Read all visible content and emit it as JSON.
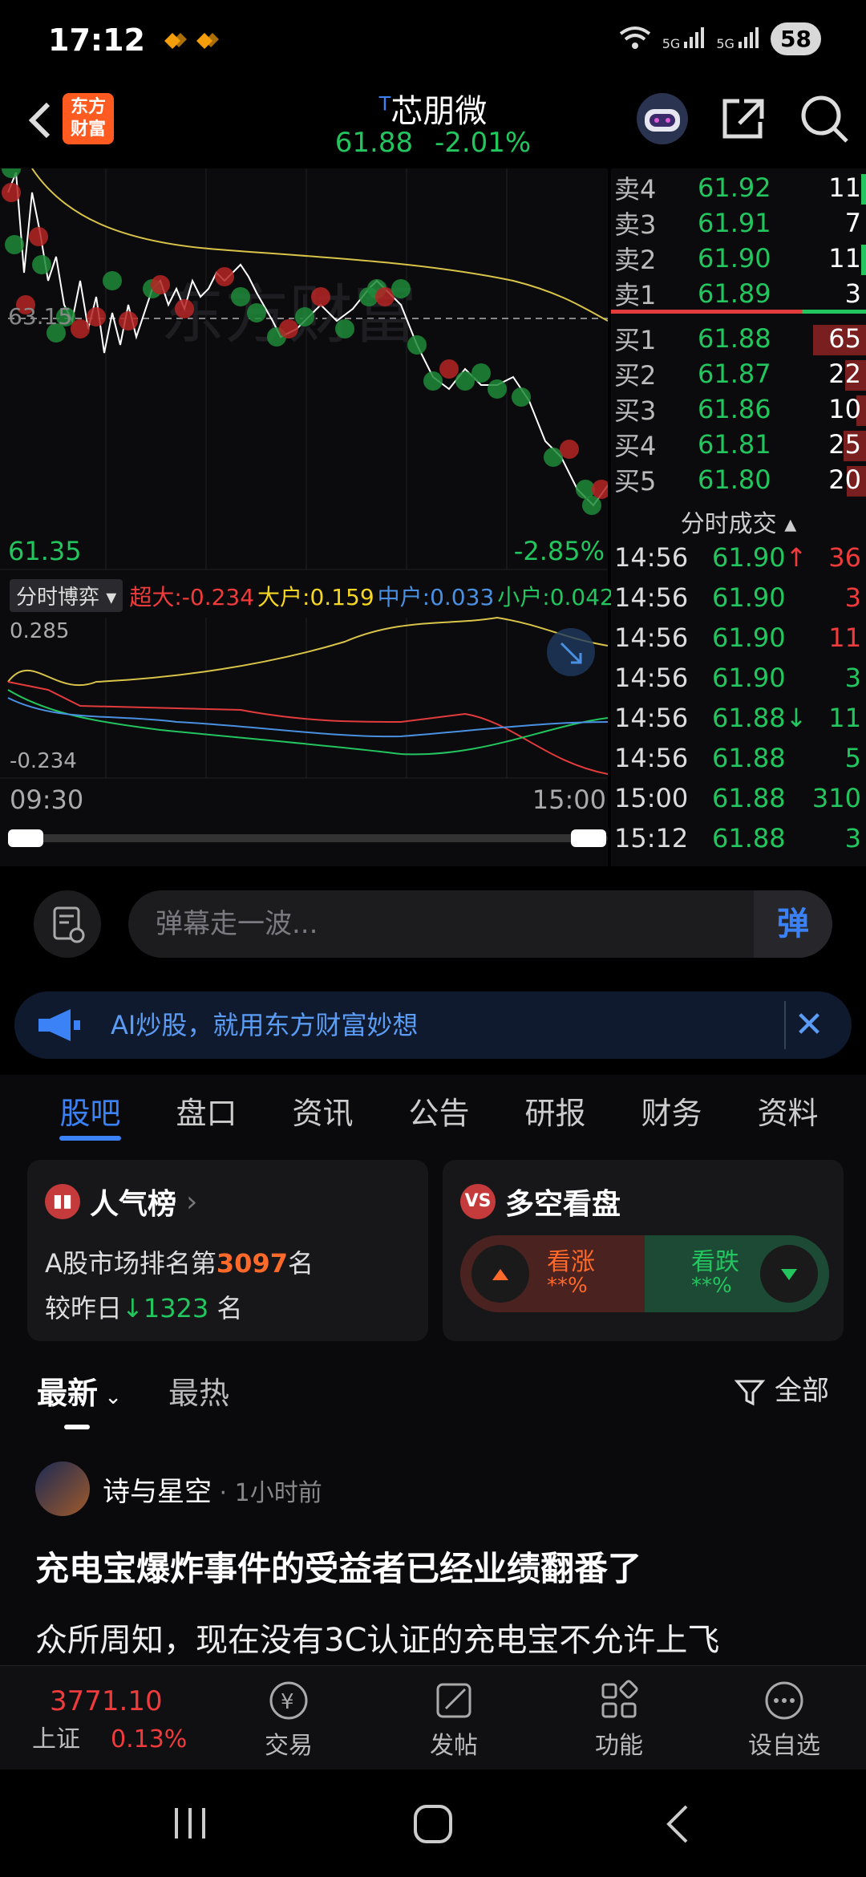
{
  "status": {
    "time": "17:12",
    "battery": "58",
    "network1": "5G",
    "network2": "5G"
  },
  "header": {
    "title_prefix": "T",
    "title": "芯朋微",
    "price": "61.88",
    "change_pct": "-2.01%"
  },
  "chart": {
    "watermark": "东方财富",
    "ref_price": "63.15",
    "low_label": "61.35",
    "low_pct": "-2.85%",
    "flow_selector": "分时博弈",
    "flow": [
      {
        "label": "超大:",
        "value": "-0.234",
        "color": "#ef3b3b"
      },
      {
        "label": "大户:",
        "value": "0.159",
        "color": "#f5d623"
      },
      {
        "label": "中户:",
        "value": "0.033",
        "color": "#4a90e2"
      },
      {
        "label": "小户:",
        "value": "0.042",
        "color": "#22c55e"
      }
    ],
    "flow_max": "0.285",
    "flow_min": "-0.234",
    "time_start": "09:30",
    "time_end": "15:00"
  },
  "orderbook": {
    "asks": [
      {
        "label": "卖4",
        "price": "61.92",
        "vol": "11"
      },
      {
        "label": "卖3",
        "price": "61.91",
        "vol": "7"
      },
      {
        "label": "卖2",
        "price": "61.90",
        "vol": "11"
      },
      {
        "label": "卖1",
        "price": "61.89",
        "vol": "3"
      }
    ],
    "bids": [
      {
        "label": "买1",
        "price": "61.88",
        "vol": "65"
      },
      {
        "label": "买2",
        "price": "61.87",
        "vol": "22"
      },
      {
        "label": "买3",
        "price": "61.86",
        "vol": "10"
      },
      {
        "label": "买4",
        "price": "61.81",
        "vol": "25"
      },
      {
        "label": "买5",
        "price": "61.80",
        "vol": "20"
      }
    ],
    "trades_title": "分时成交",
    "trades": [
      {
        "time": "14:56",
        "price": "61.90",
        "arrow": "↑",
        "vol": "36",
        "vcolor": "#ef3b3b"
      },
      {
        "time": "14:56",
        "price": "61.90",
        "arrow": "",
        "vol": "3",
        "vcolor": "#ef3b3b"
      },
      {
        "time": "14:56",
        "price": "61.90",
        "arrow": "",
        "vol": "11",
        "vcolor": "#ef3b3b"
      },
      {
        "time": "14:56",
        "price": "61.90",
        "arrow": "",
        "vol": "3",
        "vcolor": "#22c55e"
      },
      {
        "time": "14:56",
        "price": "61.88",
        "arrow": "↓",
        "vol": "11",
        "vcolor": "#22c55e"
      },
      {
        "time": "14:56",
        "price": "61.88",
        "arrow": "",
        "vol": "5",
        "vcolor": "#22c55e"
      },
      {
        "time": "15:00",
        "price": "61.88",
        "arrow": "",
        "vol": "310",
        "vcolor": "#22c55e"
      },
      {
        "time": "15:12",
        "price": "61.88",
        "arrow": "",
        "vol": "3",
        "vcolor": "#22c55e"
      }
    ]
  },
  "comment": {
    "placeholder": "弹幕走一波...",
    "send": "弹"
  },
  "ai_banner": {
    "text": "AI炒股，就用东方财富妙想"
  },
  "tabs": [
    "股吧",
    "盘口",
    "资讯",
    "公告",
    "研报",
    "财务",
    "资料"
  ],
  "popularity": {
    "title": "人气榜",
    "rank_prefix": "A股市场排名第",
    "rank": "3097",
    "rank_suffix": "名",
    "change_prefix": "较昨日",
    "change": "1323",
    "change_suffix": "名"
  },
  "vote": {
    "title": "多空看盘",
    "up_label": "看涨",
    "up_value": "**%",
    "down_label": "看跌",
    "down_value": "**%"
  },
  "sort": {
    "latest": "最新",
    "hot": "最热",
    "filter": "全部"
  },
  "post": {
    "author": "诗与星空",
    "ago": "1小时前",
    "title": "充电宝爆炸事件的受益者已经业绩翻番了",
    "body": "众所周知，现在没有3C认证的充电宝不允许上飞"
  },
  "bottom": {
    "index_value": "3771.10",
    "index_name": "上证",
    "index_pct": "0.13%",
    "items": [
      "交易",
      "发帖",
      "功能",
      "设自选"
    ]
  }
}
